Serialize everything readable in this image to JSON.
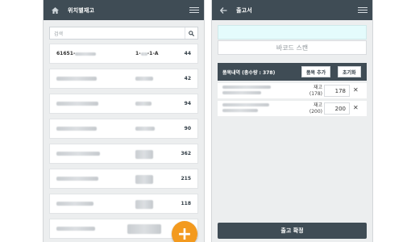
{
  "left": {
    "title": "위치별재고",
    "search_placeholder": "검색",
    "items": [
      {
        "name": "61651-",
        "loc": "1-",
        "loc_suffix": "-1-A",
        "qty": "44"
      },
      {
        "qty": "42"
      },
      {
        "qty": "94"
      },
      {
        "qty": "90"
      },
      {
        "qty": "362"
      },
      {
        "qty": "215"
      },
      {
        "qty": "118"
      },
      {
        "qty": ""
      }
    ],
    "fab_label": "+"
  },
  "right": {
    "title": "출고서",
    "scan_placeholder": "바코드 스캔",
    "items_header": "품목내역 (총수량 : 378)",
    "add_item_label": "품목 추가",
    "reset_label": "초기화",
    "rows": [
      {
        "stock_label": "재고",
        "stock_qty": "(178)",
        "qty": "178"
      },
      {
        "stock_label": "재고",
        "stock_qty": "(200)",
        "qty": "200"
      }
    ],
    "confirm_label": "출고 확정"
  },
  "colors": {
    "header": "#3f4c55",
    "accent": "#f39a1f",
    "scan_box": "#e4fbfc"
  }
}
